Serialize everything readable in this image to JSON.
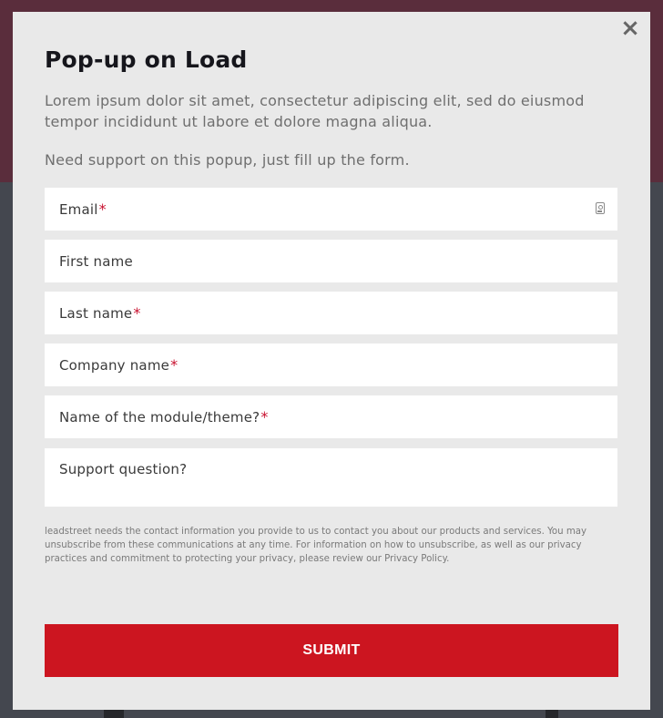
{
  "modal": {
    "close_symbol": "×",
    "title": "Pop-up on Load",
    "intro": "Lorem ipsum dolor sit amet, consectetur adipiscing elit, sed do eiusmod tempor incididunt ut labore et dolore magna aliqua.",
    "support_note": "Need support on this popup, just fill up the form."
  },
  "form": {
    "required_marker": "*",
    "fields": [
      {
        "label": "Email",
        "required": true
      },
      {
        "label": "First name",
        "required": false
      },
      {
        "label": "Last name",
        "required": true
      },
      {
        "label": "Company name",
        "required": true
      },
      {
        "label": "Name of the module/theme?",
        "required": true
      },
      {
        "label": "Support question?",
        "required": false
      }
    ],
    "legal_text": "leadstreet needs the contact information you provide to us to contact you about our products and services. You may unsubscribe from these communications at any time. For information on how to unsubscribe, as well as our privacy practices and commitment to protecting your privacy, please review our Privacy Policy.",
    "submit_label": "SUBMIT"
  },
  "colors": {
    "accent": "#cc1520",
    "required": "#c8102e",
    "modal_bg": "#e9e9e9",
    "overlay_top": "#5a2d3c",
    "overlay_bottom": "#44474f"
  },
  "icons": {
    "close": "close-icon",
    "autofill": "contact-card-icon"
  }
}
